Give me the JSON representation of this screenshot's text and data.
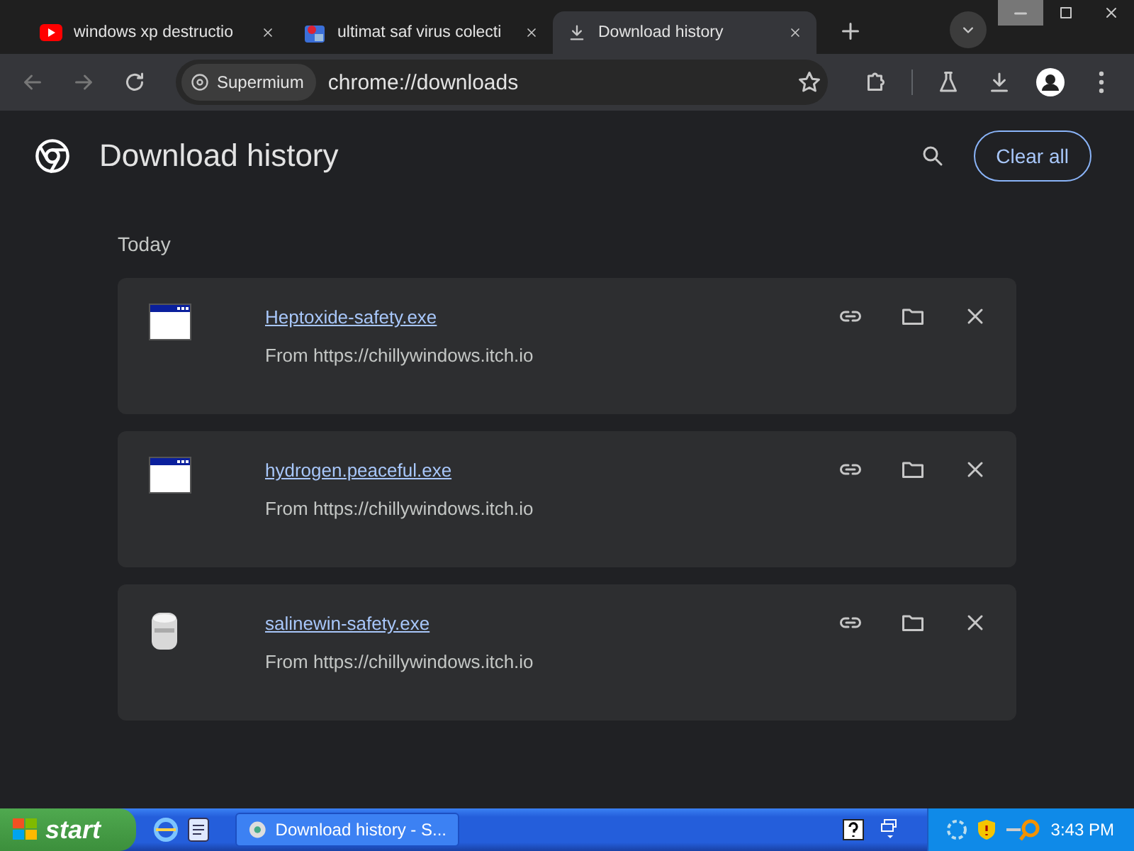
{
  "tabs": [
    {
      "title": "windows xp destructio",
      "selected": false
    },
    {
      "title": "ultimat saf virus colecti",
      "selected": false
    },
    {
      "title": "Download history",
      "selected": true
    }
  ],
  "toolbar": {
    "site_chip": "Supermium",
    "url": "chrome://downloads"
  },
  "page": {
    "title": "Download history",
    "clear_button": "Clear all",
    "section": "Today",
    "downloads": [
      {
        "kind": "window",
        "file": "Heptoxide-safety.exe",
        "source": "From https://chillywindows.itch.io"
      },
      {
        "kind": "window",
        "file": "hydrogen.peaceful.exe",
        "source": "From https://chillywindows.itch.io"
      },
      {
        "kind": "cylinder",
        "file": "salinewin-safety.exe",
        "source": "From https://chillywindows.itch.io"
      }
    ]
  },
  "taskbar": {
    "start": "start",
    "task": "Download history - S...",
    "clock": "3:43 PM"
  }
}
